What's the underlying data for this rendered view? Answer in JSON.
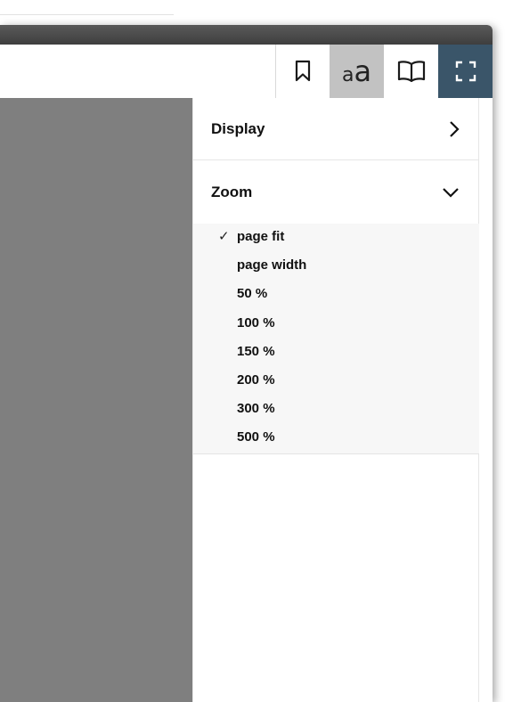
{
  "toolbar": {
    "font_icon_small": "a",
    "font_icon_big": "a",
    "buttons": [
      "bookmark-icon",
      "font-size-icon",
      "book-open-icon",
      "fullscreen-icon"
    ],
    "active_button_bg": "#c2c2c2",
    "fullscreen_button_bg": "#3a5569"
  },
  "panel": {
    "display": {
      "title": "Display",
      "icon": "chevron-right-icon"
    },
    "zoom": {
      "title": "Zoom",
      "icon": "chevron-down-icon",
      "selected_mark": "✓",
      "options": [
        {
          "label": "page fit",
          "selected": true
        },
        {
          "label": "page width",
          "selected": false
        },
        {
          "label": "50 %",
          "selected": false
        },
        {
          "label": "100 %",
          "selected": false
        },
        {
          "label": "150 %",
          "selected": false
        },
        {
          "label": "200 %",
          "selected": false
        },
        {
          "label": "300 %",
          "selected": false
        },
        {
          "label": "500 %",
          "selected": false
        }
      ]
    }
  },
  "colors": {
    "canvas": "#7f7f7f",
    "zoom_list_bg": "#f7f7f7"
  }
}
